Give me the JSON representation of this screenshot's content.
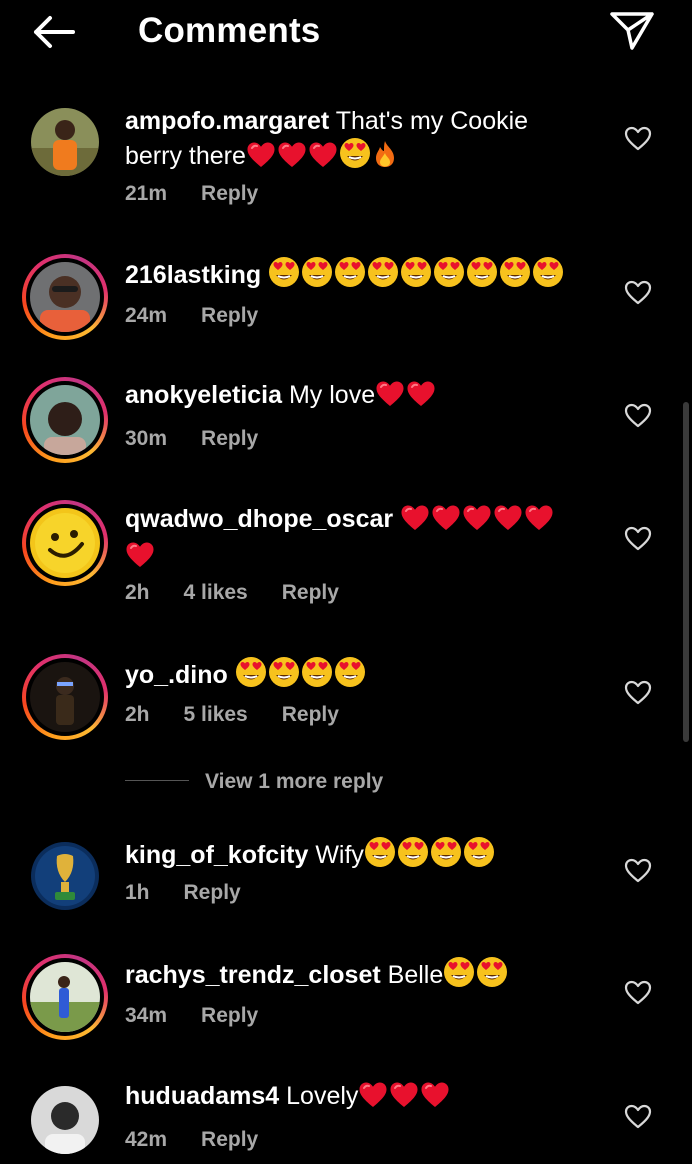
{
  "header": {
    "title": "Comments",
    "back_icon": "arrow-left-icon",
    "send_icon": "paper-plane-icon"
  },
  "colors": {
    "background": "#000000",
    "text": "#ffffff",
    "meta": "#a8a8a8",
    "heart": "#e8112d",
    "story_ring": [
      "#fdb933",
      "#ff9d1c",
      "#e1306c",
      "#c13584"
    ]
  },
  "comments": [
    {
      "username": "ampofo.margaret",
      "text": "That's my Cookie berry there",
      "emojis": [
        "red-heart",
        "red-heart",
        "red-heart",
        "heart-eyes",
        "fire"
      ],
      "time": "21m",
      "likes": "",
      "reply": "Reply",
      "story_ring": false
    },
    {
      "username": "216lastking",
      "text": "",
      "emojis": [
        "heart-eyes",
        "heart-eyes",
        "heart-eyes",
        "heart-eyes",
        "heart-eyes",
        "heart-eyes",
        "heart-eyes",
        "heart-eyes",
        "heart-eyes"
      ],
      "time": "24m",
      "likes": "",
      "reply": "Reply",
      "story_ring": true
    },
    {
      "username": "anokyeleticia",
      "text": "My love",
      "emojis": [
        "red-heart",
        "red-heart"
      ],
      "time": "30m",
      "likes": "",
      "reply": "Reply",
      "story_ring": true
    },
    {
      "username": "qwadwo_dhope_oscar",
      "text": "",
      "emojis": [
        "red-heart",
        "red-heart",
        "red-heart",
        "red-heart",
        "red-heart",
        "red-heart"
      ],
      "time": "2h",
      "likes": "4 likes",
      "reply": "Reply",
      "story_ring": true
    },
    {
      "username": "yo_.dino",
      "text": "",
      "emojis": [
        "heart-eyes",
        "heart-eyes",
        "heart-eyes",
        "heart-eyes"
      ],
      "time": "2h",
      "likes": "5 likes",
      "reply": "Reply",
      "story_ring": true
    },
    {
      "username": "king_of_kofcity",
      "text": "Wify",
      "emojis": [
        "heart-eyes",
        "heart-eyes",
        "heart-eyes",
        "heart-eyes"
      ],
      "time": "1h",
      "likes": "",
      "reply": "Reply",
      "story_ring": false
    },
    {
      "username": "rachys_trendz_closet",
      "text": "Belle",
      "emojis": [
        "heart-eyes",
        "heart-eyes"
      ],
      "time": "34m",
      "likes": "",
      "reply": "Reply",
      "story_ring": true
    },
    {
      "username": "huduadams4",
      "text": "Lovely",
      "emojis": [
        "red-heart",
        "red-heart",
        "red-heart"
      ],
      "time": "42m",
      "likes": "",
      "reply": "Reply",
      "story_ring": false
    }
  ],
  "view_more": "View 1 more reply",
  "like_icon": "heart-outline-icon"
}
